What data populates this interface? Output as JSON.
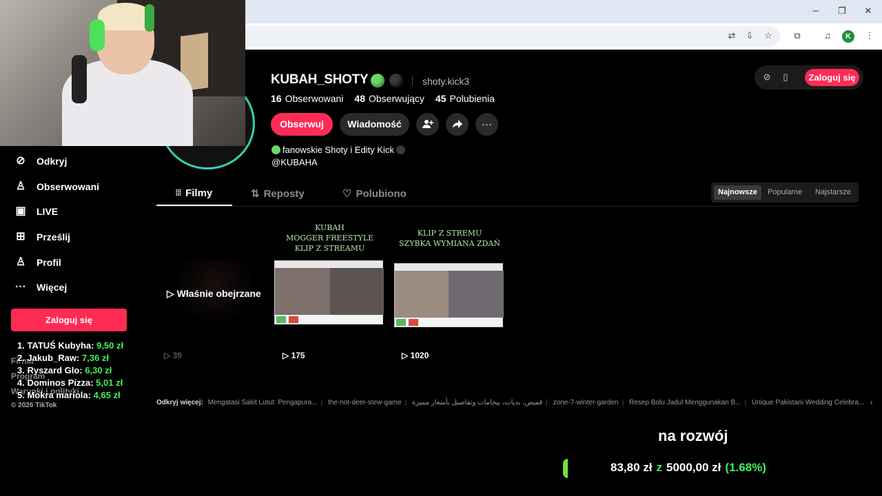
{
  "browser": {
    "icons": [
      "translate-icon",
      "install-icon",
      "star-icon",
      "extensions-icon",
      "media-icon",
      "profile-avatar",
      "menu-icon"
    ],
    "profile_initial": "K"
  },
  "sidebar": {
    "items": [
      {
        "label": "Odkryj",
        "icon": "compass-icon"
      },
      {
        "label": "Obserwowani",
        "icon": "following-icon"
      },
      {
        "label": "LIVE",
        "icon": "live-icon"
      },
      {
        "label": "Prześlij",
        "icon": "upload-icon"
      },
      {
        "label": "Profil",
        "icon": "profile-icon"
      },
      {
        "label": "Więcej",
        "icon": "more-icon"
      }
    ],
    "login_label": "Zaloguj się",
    "footer_links": [
      "Firma",
      "Program",
      "Warunki i polityki"
    ],
    "copyright": "© 2026 TikTok"
  },
  "donors": [
    {
      "rank_name": "1. TATUŚ Kubyha:",
      "amount": "9,50 zł"
    },
    {
      "rank_name": "2. Jakub_Raw:",
      "amount": "7,36 zł"
    },
    {
      "rank_name": "3. Ryszard Glo:",
      "amount": "6,30 zł"
    },
    {
      "rank_name": "4. Dominos Pizza:",
      "amount": "5,01 zł"
    },
    {
      "rank_name": "5. Mokra mariola:",
      "amount": "4,65 zł"
    }
  ],
  "profile": {
    "username": "KUBAH_SHOTY",
    "nickname": "shoty.kick3",
    "stats": [
      {
        "value": "16",
        "label": "Obserwowani"
      },
      {
        "value": "48",
        "label": "Obserwujący"
      },
      {
        "value": "45",
        "label": "Polubienia"
      }
    ],
    "follow_label": "Obserwuj",
    "message_label": "Wiadomość",
    "bio_line1": "fanowskie Shoty i Edity Kick",
    "bio_line2": "@KUBAHA"
  },
  "header_login": "Zaloguj się",
  "tabs": [
    {
      "label": "Filmy",
      "icon": "grid-icon"
    },
    {
      "label": "Reposty",
      "icon": "repost-icon"
    },
    {
      "label": "Polubiono",
      "icon": "like-icon"
    }
  ],
  "sort": [
    "Najnowsze",
    "Popularne",
    "Najstarsze"
  ],
  "videos": [
    {
      "title": "",
      "views": "39",
      "overlay": "Właśnie obejrzane"
    },
    {
      "title": "KUBAH\nMOGGER FREESTYLE\nKLIP Z STREAMU",
      "views": "175"
    },
    {
      "title": "KLIP Z STREMU\nSZYBKA WYMIANA ZDAŃ",
      "views": "1020"
    }
  ],
  "discover": {
    "label": "Odkryj więcej:",
    "items": [
      "Mengatasi Sakit Lutut: Pengapura...",
      "the-not-deer-stew-game",
      "قميص، بديات، بيجامات وتفاصيل بأسعار مميزة",
      "zone-7-winter-garden",
      "Resep Bolu Jadul Menggunakan B...",
      "Unique Pakistani Wedding Celebra..."
    ]
  },
  "goal": {
    "title": "na rozwój",
    "current": "83,80 zł",
    "z": "z",
    "target": "5000,00 zł",
    "percent": "(1.68%)",
    "progress": 0.0168
  }
}
